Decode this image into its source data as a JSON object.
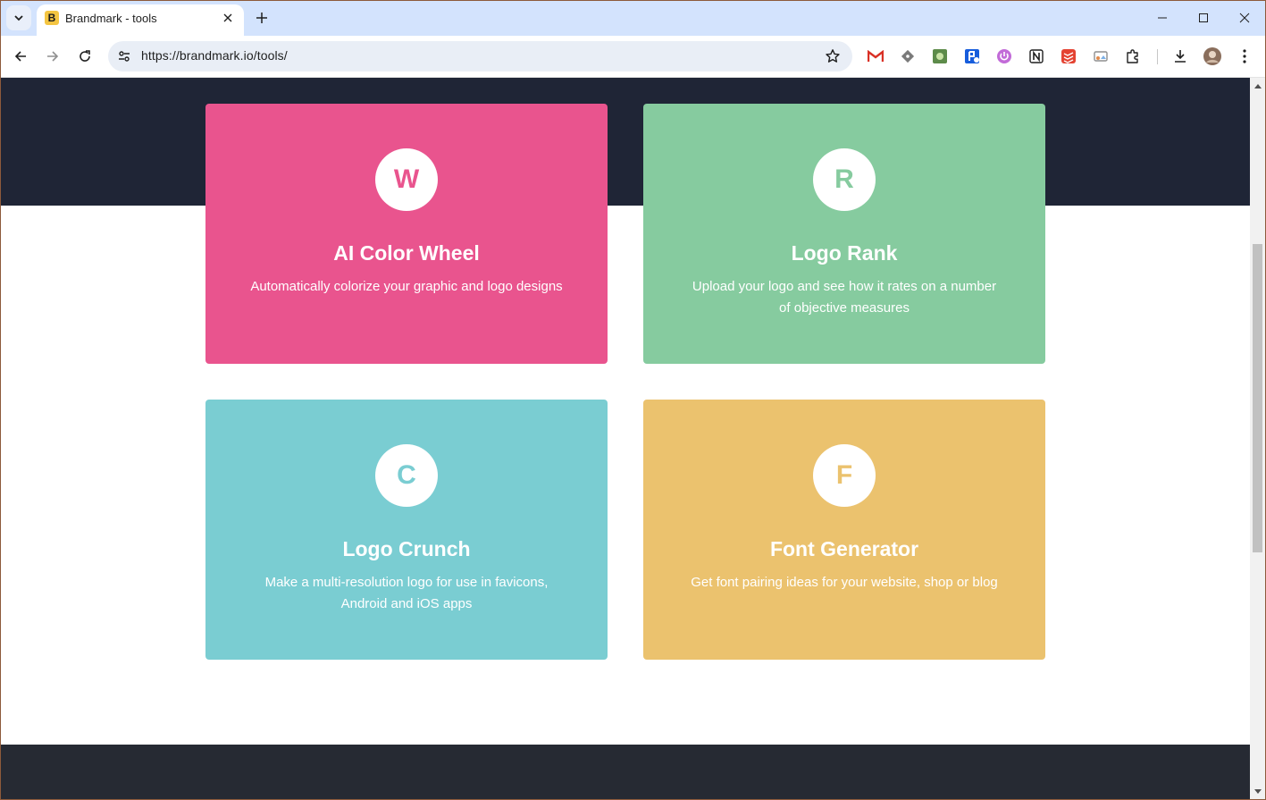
{
  "browser": {
    "tab_title": "Brandmark - tools",
    "favicon_letter": "B",
    "url": "https://brandmark.io/tools/"
  },
  "colors": {
    "hero": "#1f2536",
    "footer": "#262a33",
    "pink": "#e9548e",
    "green": "#86cb9f",
    "teal": "#7acdd2",
    "yellow": "#ebc26e"
  },
  "tools": [
    {
      "badge": "W",
      "title": "AI Color Wheel",
      "description": "Automatically colorize your graphic and logo designs",
      "color": "#e9548e"
    },
    {
      "badge": "R",
      "title": "Logo Rank",
      "description": "Upload your logo and see how it rates on a number of objective measures",
      "color": "#86cb9f"
    },
    {
      "badge": "C",
      "title": "Logo Crunch",
      "description": "Make a multi-resolution logo for use in favicons, Android and iOS apps",
      "color": "#7acdd2"
    },
    {
      "badge": "F",
      "title": "Font Generator",
      "description": "Get font pairing ideas for your website, shop or blog",
      "color": "#ebc26e"
    }
  ],
  "extensions": [
    "gmail-icon",
    "git-icon",
    "photo-icon",
    "bitwarden-icon",
    "power-icon",
    "notion-icon",
    "todoist-icon",
    "cast-icon",
    "puzzle-icon"
  ]
}
